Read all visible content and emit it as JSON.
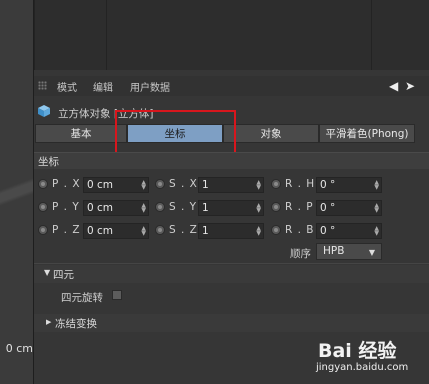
{
  "viewport": {
    "coord_text": "0 cm"
  },
  "menubar": {
    "items": [
      "模式",
      "编辑",
      "用户数据"
    ]
  },
  "object": {
    "title": "立方体对象 [立方体]"
  },
  "tabs": [
    {
      "label": "基本",
      "active": false
    },
    {
      "label": "坐标",
      "active": true
    },
    {
      "label": "对象",
      "active": false
    },
    {
      "label": "平滑着色(Phong)",
      "active": false
    }
  ],
  "coord_section": {
    "title": "坐标",
    "position": {
      "x_label": "P . X",
      "y_label": "P . Y",
      "z_label": "P . Z",
      "x": "0 cm",
      "y": "0 cm",
      "z": "0 cm"
    },
    "scale": {
      "x_label": "S . X",
      "y_label": "S . Y",
      "z_label": "S . Z",
      "x": "1",
      "y": "1",
      "z": "1"
    },
    "rotation": {
      "h_label": "R . H",
      "p_label": "R . P",
      "b_label": "R . B",
      "h": "0 °",
      "p": "0 °",
      "b": "0 °"
    },
    "order_label": "顺序",
    "order_value": "HPB"
  },
  "quaternion": {
    "title": "四元",
    "rotation_label": "四元旋转",
    "checked": false
  },
  "freeze": {
    "title": "冻结变换"
  },
  "watermark": {
    "logo": "Bai 经验",
    "url": "jingyan.baidu.com"
  },
  "colors": {
    "active_tab": "#7e9fc4",
    "highlight_box": "#d8161d",
    "panel_bg": "#363636"
  }
}
